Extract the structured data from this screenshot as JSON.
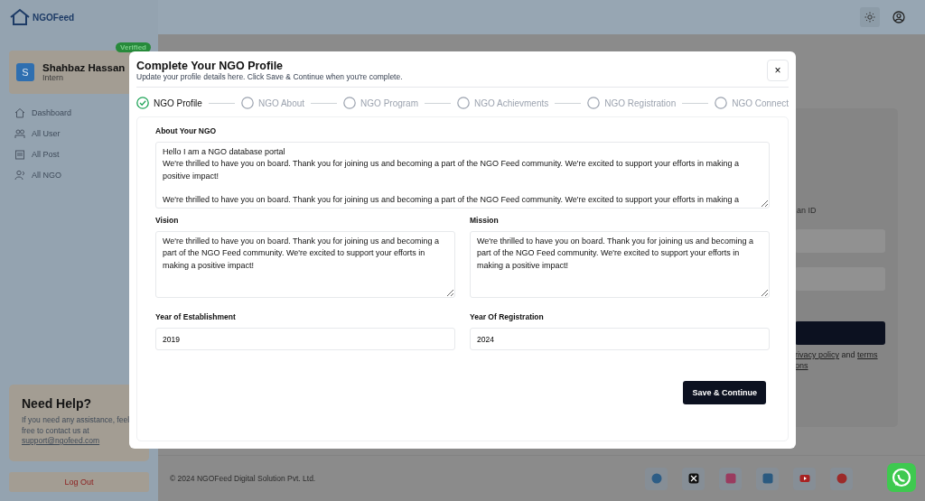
{
  "sidebar": {
    "logo": "NGOFeed",
    "user": {
      "initial": "S",
      "name": "Shahbaz Hassan",
      "role": "Intern",
      "badge": "Verified"
    },
    "items": [
      {
        "label": "Dashboard"
      },
      {
        "label": "All User"
      },
      {
        "label": "All Post"
      },
      {
        "label": "All NGO"
      }
    ],
    "help": {
      "title": "Need Help?",
      "text": "If you need any assistance, feel free to contact us at",
      "email": "support@ngofeed.com"
    },
    "logout": "Log Out"
  },
  "background_card": {
    "texts": [
      "an ID"
    ],
    "consent": "rivacy policy",
    "consent_join": " and ",
    "consent_link": "terms",
    "consent_tail": "ons"
  },
  "footer": {
    "copyright": "© 2024 NGOFeed Digital Solution Pvt. Ltd."
  },
  "modal": {
    "title": "Complete Your NGO Profile",
    "subtitle": "Update your profile details here. Click Save & Continue when you're complete.",
    "close": "×",
    "steps": [
      {
        "label": "NGO Profile",
        "completed": true
      },
      {
        "label": "NGO About",
        "completed": false
      },
      {
        "label": "NGO Program",
        "completed": false
      },
      {
        "label": "NGO Achievments",
        "completed": false
      },
      {
        "label": "NGO Registration",
        "completed": false
      },
      {
        "label": "NGO Connect",
        "completed": false
      }
    ],
    "about": {
      "label": "About Your NGO",
      "value": "Hello I am a NGO database portal\nWe're thrilled to have you on board. Thank you for joining us and becoming a part of the NGO Feed community. We're excited to support your efforts in making a positive impact!\n\nWe're thrilled to have you on board. Thank you for joining us and becoming a part of the NGO Feed community. We're excited to support your efforts in making a"
    },
    "vision": {
      "label": "Vision",
      "value": "We're thrilled to have you on board. Thank you for joining us and becoming a part of the NGO Feed community. We're excited to support your efforts in making a positive impact!"
    },
    "mission": {
      "label": "Mission",
      "value": "We're thrilled to have you on board. Thank you for joining us and becoming a part of the NGO Feed community. We're excited to support your efforts in making a positive impact!"
    },
    "establishment": {
      "label": "Year of Establishment",
      "value": "2019"
    },
    "registration": {
      "label": "Year Of Registration",
      "value": "2024"
    },
    "submit": "Save & Continue"
  }
}
